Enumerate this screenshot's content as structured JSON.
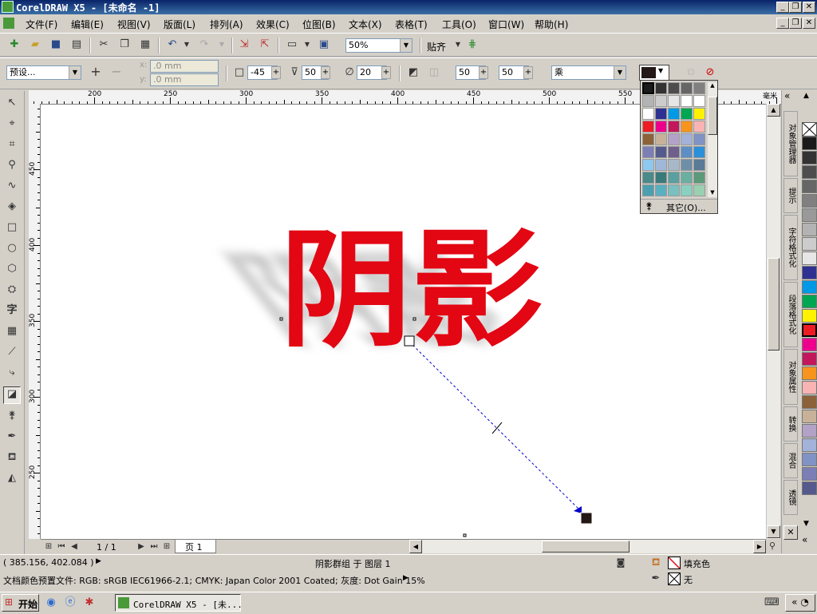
{
  "window": {
    "title": "CorelDRAW X5 - [未命名 -1]",
    "minimize": "_",
    "restore": "❐",
    "close": "✕"
  },
  "menu": [
    "文件(F)",
    "编辑(E)",
    "视图(V)",
    "版面(L)",
    "排列(A)",
    "效果(C)",
    "位图(B)",
    "文本(X)",
    "表格(T)",
    "工具(O)",
    "窗口(W)",
    "帮助(H)"
  ],
  "standard_toolbar": {
    "zoom": "50%",
    "snap": "贴齐"
  },
  "property_bar": {
    "preset": "预设...",
    "offset_x": ".0 mm",
    "offset_y": ".0 mm",
    "x_label": "x:",
    "y_label": "y:",
    "angle": "-45",
    "opacity": "50",
    "feather": "20",
    "fade": "50",
    "stretch": "50",
    "mode": "乘"
  },
  "ruler": {
    "h_labels": [
      "200",
      "250",
      "300",
      "350",
      "400",
      "450",
      "500",
      "550"
    ],
    "v_labels": [
      "450",
      "400",
      "350",
      "300",
      "250"
    ],
    "unit": "毫米"
  },
  "artwork": {
    "text": "阴影",
    "color": "#e30613"
  },
  "color_popup": {
    "other": "其它(O)...",
    "colors": [
      "#1a1a1a",
      "#333333",
      "#4d4d4d",
      "#666666",
      "#808080",
      "#999999",
      "#b3b3b3",
      "#cccccc",
      "#e6e6e6",
      "#ffffff",
      "#ffffff",
      "#f2f2f2",
      "#ffffff",
      "#2e3192",
      "#0099e6",
      "#00a651",
      "#fff200",
      "#ffffff",
      "#ed1c24",
      "#ec008c",
      "#c2185b",
      "#f7941d",
      "#f9b3b3",
      "#ffffff",
      "#8c6239",
      "#c7b299",
      "#b3a2c7",
      "#a3b2d9",
      "#8093c4",
      "#ffffff",
      "#7b7fb5",
      "#555a8c",
      "#6f5f8c",
      "#5d8fc4",
      "#2b90d9",
      "#ffffff",
      "#8ec8f0",
      "#9fb8d9",
      "#a7b9c9",
      "#6e8fa8",
      "#5a7a95",
      "#ffffff",
      "#4a8a8a",
      "#3a7a7a",
      "#5aa0a0",
      "#6ab0a0",
      "#5a9a7a",
      "#ffffff",
      "#4aa0b0",
      "#5ab0c0",
      "#7ac0c0",
      "#8ad0c0",
      "#9ad0b0",
      "#ffffff"
    ]
  },
  "dockers": [
    "对象管理器",
    "提示",
    "字符格式化",
    "段落格式化",
    "对象属性",
    "转换",
    "混合",
    "透镜"
  ],
  "palette": [
    "#ffffff",
    "#1a1a1a",
    "#333333",
    "#4d4d4d",
    "#666666",
    "#808080",
    "#999999",
    "#b3b3b3",
    "#cccccc",
    "#e6e6e6",
    "#2e3192",
    "#0099e6",
    "#00a651",
    "#fff200",
    "#ed1c24",
    "#ec008c",
    "#c2185b",
    "#f7941d",
    "#f9b3b3",
    "#8c6239",
    "#c7b299",
    "#b3a2c7",
    "#a3b2d9",
    "#8093c4",
    "#7b7fb5",
    "#555a8c"
  ],
  "page_nav": {
    "counter": "1 / 1",
    "tab": "页 1"
  },
  "status": {
    "coords": "( 385.156, 402.084 )",
    "selection": "阴影群组 于 图层 1",
    "profile": "文档颜色预置文件: RGB: sRGB IEC61966-2.1; CMYK: Japan Color 2001 Coated; 灰度: Dot Gain 15%",
    "fill_label": "填充色",
    "outline_label": "无"
  },
  "taskbar": {
    "start": "开始",
    "task": "CorelDRAW X5 - [未..."
  }
}
